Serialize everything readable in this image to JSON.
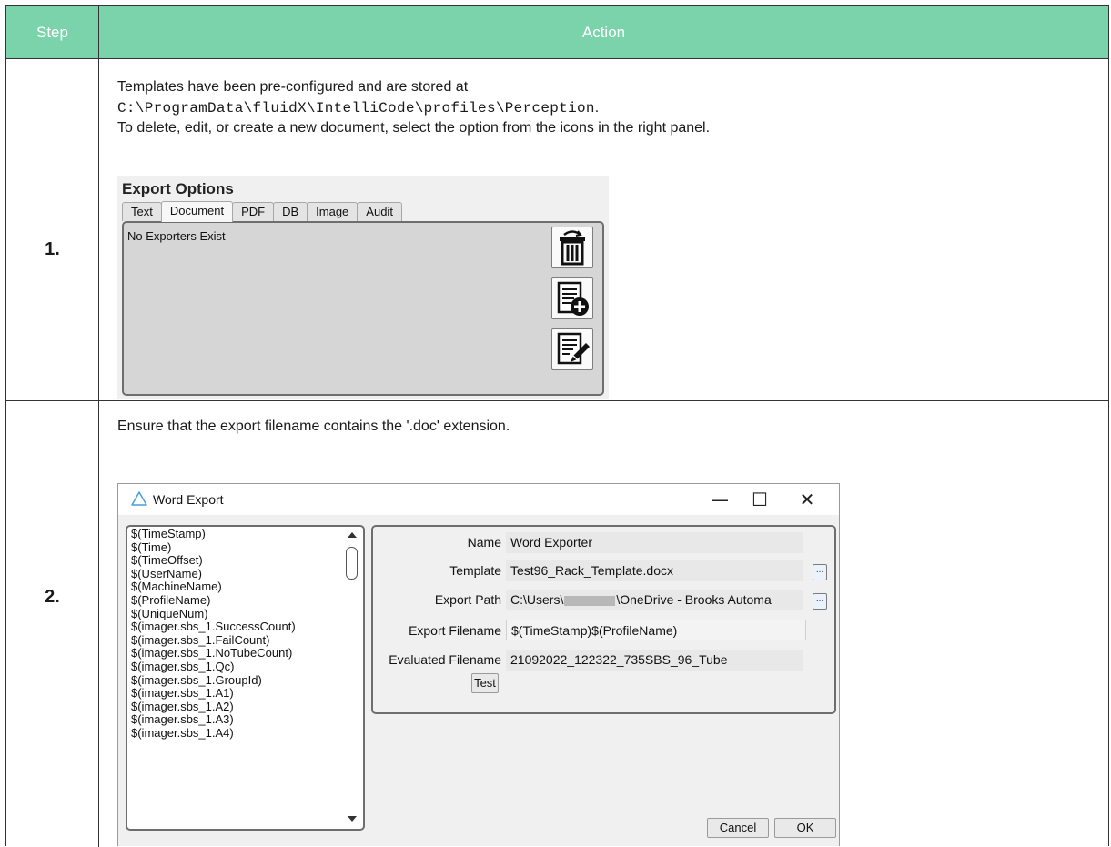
{
  "table": {
    "header": {
      "step": "Step",
      "action": "Action"
    },
    "rows": [
      {
        "step": "1.",
        "text_line1": "Templates have been pre-configured and are stored at",
        "path": "C:\\ProgramData\\fluidX\\IntelliCode\\profiles\\Perception",
        "path_suffix": ".",
        "text_line3": "To delete, edit, or create a new document, select the option from the icons in the right panel."
      },
      {
        "step": "2.",
        "text": "Ensure that the export filename contains the '.doc' extension."
      }
    ]
  },
  "export_options": {
    "title": "Export Options",
    "tabs": [
      "Text",
      "Document",
      "PDF",
      "DB",
      "Image",
      "Audit"
    ],
    "active_tab": "Document",
    "empty_message": "No Exporters Exist",
    "buttons": [
      "trash-icon",
      "add-document-icon",
      "edit-document-icon"
    ]
  },
  "word_export": {
    "title": "Word Export",
    "window_controls": {
      "minimize": "—",
      "maximize": "☐",
      "close": "✕"
    },
    "variables": [
      "$(TimeStamp)",
      "$(Time)",
      "$(TimeOffset)",
      "$(UserName)",
      "$(MachineName)",
      "$(ProfileName)",
      "$(UniqueNum)",
      "$(imager.sbs_1.SuccessCount)",
      "$(imager.sbs_1.FailCount)",
      "$(imager.sbs_1.NoTubeCount)",
      "$(imager.sbs_1.Qc)",
      "$(imager.sbs_1.GroupId)",
      "$(imager.sbs_1.A1)",
      "$(imager.sbs_1.A2)",
      "$(imager.sbs_1.A3)",
      "$(imager.sbs_1.A4)"
    ],
    "fields": {
      "name_label": "Name",
      "name_value": "Word Exporter",
      "template_label": "Template",
      "template_value": "Test96_Rack_Template.docx",
      "export_path_label": "Export Path",
      "export_path_prefix": "C:\\Users\\",
      "export_path_suffix": "\\OneDrive - Brooks Automa",
      "export_filename_label": "Export Filename",
      "export_filename_value": "$(TimeStamp)$(ProfileName)",
      "evaluated_label": "Evaluated Filename",
      "evaluated_value": "21092022_122322_735SBS_96_Tube"
    },
    "browse_label": "...",
    "test_label": "Test",
    "cancel_label": "Cancel",
    "ok_label": "OK"
  }
}
